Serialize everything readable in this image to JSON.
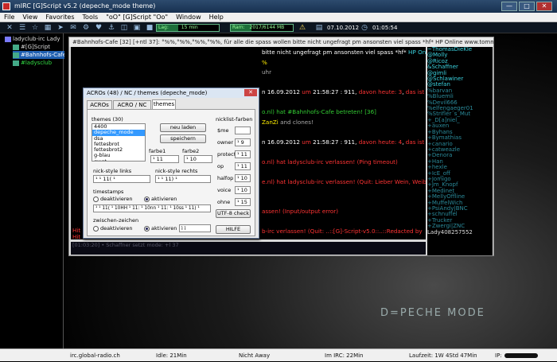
{
  "window": {
    "title": "mIRC [G]Script v5.2 (depeche_mode theme)"
  },
  "menu": [
    "File",
    "View",
    "Favorites",
    "Tools",
    "\"oO\" [G]Script \"Oo\"",
    "Window",
    "Help"
  ],
  "toolbar": {
    "lag_label": "Lag:",
    "lag_value": "15 min",
    "lag_fraction": 0.35,
    "ram_label": "Ram:",
    "ram_value": "2017/6144 MB",
    "ram_fraction": 0.33,
    "date": "07.10.2012",
    "time": "01:05:54"
  },
  "tree": [
    {
      "label": "ladyclub-irc Lady",
      "color": "#dddddd",
      "icon": "#7a7aff"
    },
    {
      "label": "#[G]Script",
      "color": "#dddddd",
      "icon": "#4a8"
    },
    {
      "label": "#Bahnhofs-Cafe",
      "color": "#ffffff",
      "icon": "#4a8",
      "selected": true
    },
    {
      "label": "#ladysclub",
      "color": "#33dd44",
      "icon": "#4a8"
    }
  ],
  "channel": {
    "caption": "#Bahnhofs-Cafe [32] [+ntl 37]: °%%,°%%,°%%,°%%, für alle die spass wollen bitte nicht ungefragt pm ansonsten viel spass *hf* HP Online www.tommys-...",
    "lines": [
      {
        "parts": [
          {
            "t": "bitte nicht ungefragt pm ansonsten viel spass *hf* ",
            "c": "#ffffff"
          },
          {
            "t": "HP Online",
            "c": "#3ad3e0"
          }
        ]
      },
      {
        "parts": [
          {
            "t": "%",
            "c": "#ffee00"
          }
        ]
      },
      {
        "parts": [
          {
            "t": "uhr",
            "c": "#aaaaaa"
          }
        ]
      },
      {
        "parts": [
          {
            "t": "",
            "c": "#ffffff"
          }
        ]
      },
      {
        "parts": [
          {
            "t": "n 16.09.2012 ",
            "c": "#ffffff"
          },
          {
            "t": "um",
            "c": "#ff3333"
          },
          {
            "t": " 21:58:27 ",
            "c": "#ffffff"
          },
          {
            "t": ": 911, ",
            "c": "#ffffff"
          },
          {
            "t": "davon heute: 3",
            "c": "#ff3333"
          },
          {
            "t": ", ",
            "c": "#ffffff"
          },
          {
            "t": "das ist der",
            "c": "#ff3333"
          }
        ]
      },
      {
        "parts": [
          {
            "t": "",
            "c": "#ffffff"
          }
        ]
      },
      {
        "parts": [
          {
            "t": "o.nl) ",
            "c": "#33cc33"
          },
          {
            "t": "hat #Bahnhofs-Cafe betreten! ",
            "c": "#33cc33"
          },
          {
            "t": "[36]",
            "c": "#33cc33"
          }
        ]
      },
      {
        "parts": [
          {
            "t": "ZanZi",
            "c": "#ffee00"
          },
          {
            "t": " and clones!",
            "c": "#aaaaaa"
          }
        ]
      },
      {
        "parts": [
          {
            "t": "",
            "c": "#ffffff"
          }
        ]
      },
      {
        "parts": [
          {
            "t": "n 16.09.2012 ",
            "c": "#ffffff"
          },
          {
            "t": "um",
            "c": "#ff3333"
          },
          {
            "t": " 21:58:27 ",
            "c": "#ffffff"
          },
          {
            "t": ": 911, ",
            "c": "#ffffff"
          },
          {
            "t": "davon heute: 4",
            "c": "#ff3333"
          },
          {
            "t": ", ",
            "c": "#ffffff"
          },
          {
            "t": "das ist der",
            "c": "#ff3333"
          }
        ]
      },
      {
        "parts": [
          {
            "t": "",
            "c": "#ffffff"
          }
        ]
      },
      {
        "parts": [
          {
            "t": "o.nl) ",
            "c": "#ff3333"
          },
          {
            "t": "hat ladysclub-irc verlassen! ",
            "c": "#ff3333"
          },
          {
            "t": "(Ping timeout)",
            "c": "#ff3333"
          }
        ]
      },
      {
        "parts": [
          {
            "t": "",
            "c": "#ffffff"
          }
        ]
      },
      {
        "parts": [
          {
            "t": "e.nl) ",
            "c": "#ff3333"
          },
          {
            "t": "hat ladysclub-irc verlassen! ",
            "c": "#ff3333"
          },
          {
            "t": "(Quit: Lieber Wein, Weib und",
            "c": "#ff3333"
          }
        ]
      },
      {
        "parts": [
          {
            "t": "",
            "c": "#ffffff"
          }
        ]
      },
      {
        "parts": [
          {
            "t": "",
            "c": "#ffffff"
          }
        ]
      },
      {
        "parts": [
          {
            "t": "assen! (Input/output error)",
            "c": "#ff3333"
          }
        ]
      },
      {
        "parts": [
          {
            "t": "",
            "c": "#ffffff"
          }
        ]
      },
      {
        "parts": [
          {
            "t": "b-irc verlassen! ",
            "c": "#ff3333"
          },
          {
            "t": "(Quit: ..::[G]-Script-v5.0::..::Redacted by",
            "c": "#ff3333"
          }
        ]
      }
    ],
    "left_lines": [
      {
        "t": "Hit",
        "c": "#ff3333"
      },
      {
        "t": "Hit",
        "c": "#ff3333"
      },
      {
        "t": "Hit",
        "c": "#ff3333"
      }
    ],
    "input_text": "[01:03:20] • Schaffner setzt mode: +l 37",
    "nicks": [
      {
        "n": "~ThomasDieKle",
        "c": "#3ad3e0"
      },
      {
        "n": "@Molly",
        "c": "#3ad3e0"
      },
      {
        "n": "@Ricoz",
        "c": "#3ad3e0"
      },
      {
        "n": "&Schaffner",
        "c": "#3ad3e0"
      },
      {
        "n": "@gimli",
        "c": "#3ad3e0"
      },
      {
        "n": "@Schlawiner",
        "c": "#3ad3e0"
      },
      {
        "n": "@stefan",
        "c": "#3ad3e0"
      },
      {
        "n": "%barvan",
        "c": "#2a8a9a"
      },
      {
        "n": "%Bluemli",
        "c": "#2a8a9a"
      },
      {
        "n": "%Devil666",
        "c": "#2a8a9a"
      },
      {
        "n": "%elfengaeger01",
        "c": "#2a8a9a"
      },
      {
        "n": "%Strifler´s_Mut",
        "c": "#2a8a9a"
      },
      {
        "n": "+_D[a]niel_",
        "c": "#2a8a9a"
      },
      {
        "n": "+auxen",
        "c": "#2a8a9a"
      },
      {
        "n": "+Byhans",
        "c": "#2a8a9a"
      },
      {
        "n": "+Bymathias",
        "c": "#2a8a9a"
      },
      {
        "n": "+canario",
        "c": "#2a8a9a"
      },
      {
        "n": "+catweazle",
        "c": "#2a8a9a"
      },
      {
        "n": "+Denora",
        "c": "#2a8a9a"
      },
      {
        "n": "+Han",
        "c": "#2a8a9a"
      },
      {
        "n": "+hexle",
        "c": "#2a8a9a"
      },
      {
        "n": "+IcE_off",
        "c": "#2a8a9a"
      },
      {
        "n": "+Jomigo",
        "c": "#2a8a9a"
      },
      {
        "n": "+Jm_Knopf",
        "c": "#2a8a9a"
      },
      {
        "n": "+Medinet",
        "c": "#2a8a9a"
      },
      {
        "n": "+MellyOffline",
        "c": "#2a8a9a"
      },
      {
        "n": "+MuffelWich",
        "c": "#2a8a9a"
      },
      {
        "n": "+PsiAndy|BNC",
        "c": "#2a8a9a"
      },
      {
        "n": "+schnuffel",
        "c": "#2a8a9a"
      },
      {
        "n": "+Trucker",
        "c": "#2a8a9a"
      },
      {
        "n": "+Zwergi|ZNC",
        "c": "#2a8a9a"
      },
      {
        "n": "Lady408257552",
        "c": "#dddddd"
      }
    ]
  },
  "dialog": {
    "title": "ACROs (48) / NC / themes (depeche_mode)",
    "tabs": [
      "ACROs",
      "ACRO / NC",
      "themes"
    ],
    "active_tab": "themes",
    "themes_label": "themes (30)",
    "themes": [
      "4400",
      "depeche_mode",
      "dsa",
      "fettesbrot",
      "fettesbrot2",
      "g-blau",
      "gwot"
    ],
    "selected_theme": "depeche_mode",
    "btn_load": "neu laden",
    "btn_save": "speichern",
    "farbe1_label": "farbe1",
    "farbe1_value": "¹ 11",
    "farbe2_label": "farbe2",
    "farbe2_value": "¹ 10",
    "nickstyle_links_label": "nick-style links",
    "nickstyle_links_value": "¹ ¹ 11( ¹",
    "nickstyle_rechts_label": "nick-style rechts",
    "nickstyle_rechts_value": "¹ ¹ 11) ¹",
    "timestamps_label": "timestamps",
    "ts_off": "deaktivieren",
    "ts_on": "aktivieren",
    "timestamps_enabled": true,
    "ts_format": "¹ ¹ 11( ¹ 10HH ¹ 11: ¹ 10nn ¹ 11: ¹ 10ss ¹ 11) ¹",
    "zwischen_label": "zwischen-zeichen",
    "zz_off": "deaktivieren",
    "zz_on": "aktivieren",
    "zwischen_enabled": true,
    "zz_value": "ì ì",
    "nicklist_label": "nicklist-farben",
    "nicklist": [
      {
        "label": "$me",
        "value": ""
      },
      {
        "label": "owner",
        "value": "¹ 9"
      },
      {
        "label": "protect",
        "value": "¹ 11"
      },
      {
        "label": "op",
        "value": "¹ 11"
      },
      {
        "label": "halfop",
        "value": "¹ 10"
      },
      {
        "label": "voice",
        "value": "¹ 10"
      },
      {
        "label": "ohne",
        "value": "¹ 15"
      }
    ],
    "btn_utf8": "UTF-8 check",
    "btn_help": "HILFE"
  },
  "status": {
    "server": "irc.global-radio.ch",
    "idle": "Idle: 21Min",
    "away": "Nicht Away",
    "im_irc": "Im IRC: 22Min",
    "laufzeit": "Laufzeit: 1W 4Std 47Min",
    "ip": "IP:"
  },
  "logo_text": "D=PECHE MODE"
}
